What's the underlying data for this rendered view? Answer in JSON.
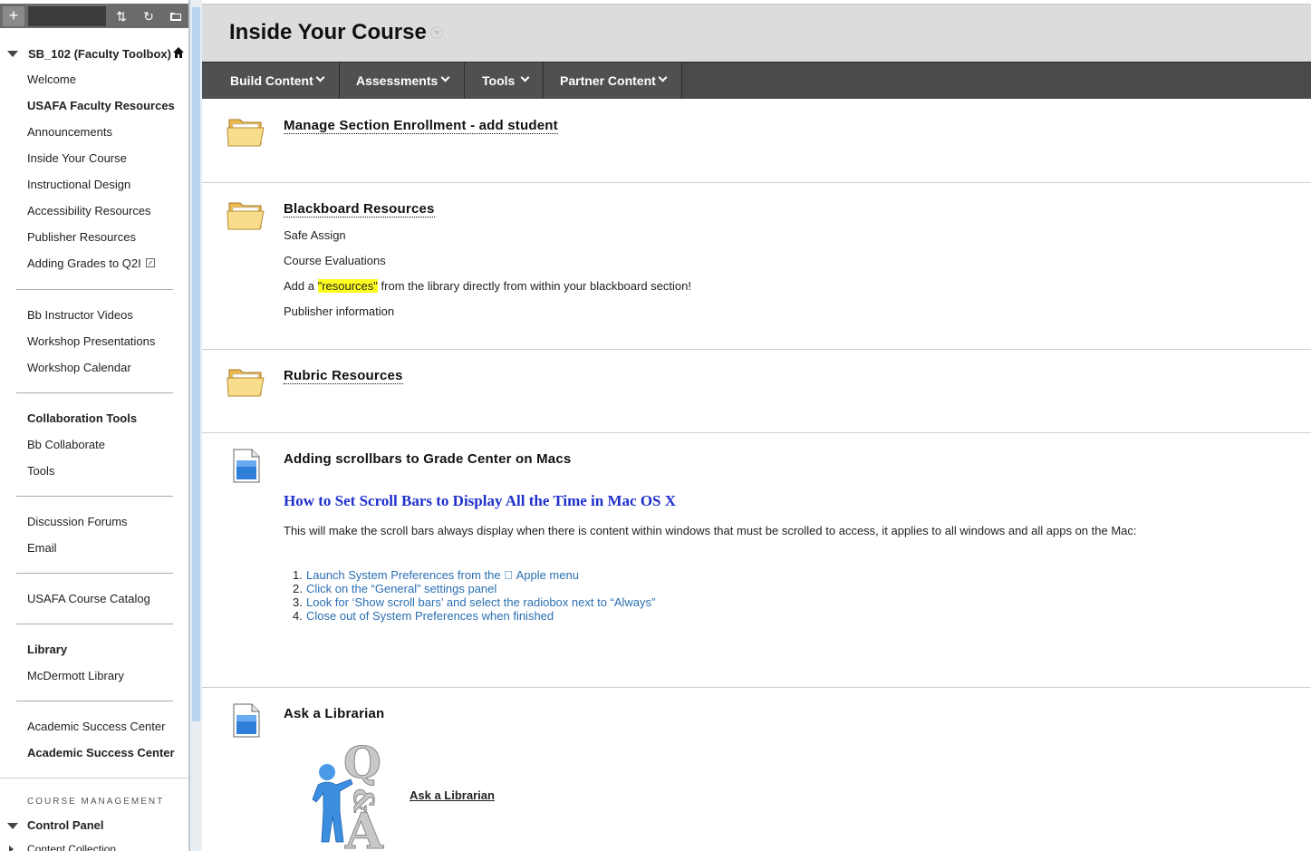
{
  "sidebar": {
    "toolbar": {
      "add_icon": "plus-icon",
      "sort_icon": "sort-arrows-icon",
      "refresh_icon": "refresh-icon",
      "folder_icon": "folder-view-icon"
    },
    "course_title": "SB_102 (Faculty Toolbox)",
    "items": [
      {
        "label": "Welcome",
        "bold": false
      },
      {
        "label": "USAFA Faculty Resources",
        "bold": true
      },
      {
        "label": "Announcements",
        "bold": false
      },
      {
        "label": "Inside Your Course",
        "bold": false
      },
      {
        "label": "Instructional Design",
        "bold": false
      },
      {
        "label": "Accessibility Resources",
        "bold": false
      },
      {
        "label": "Publisher Resources",
        "bold": false
      },
      {
        "label": "Adding Grades to Q2I",
        "bold": false
      },
      {
        "label": "Bb Instructor Videos",
        "bold": false
      },
      {
        "label": "Workshop Presentations",
        "bold": false
      },
      {
        "label": "Workshop Calendar",
        "bold": false
      },
      {
        "label": "Collaboration Tools",
        "bold": true
      },
      {
        "label": "Bb Collaborate",
        "bold": false
      },
      {
        "label": "Tools",
        "bold": false
      },
      {
        "label": "Discussion Forums",
        "bold": false
      },
      {
        "label": "Email",
        "bold": false
      },
      {
        "label": "USAFA Course Catalog",
        "bold": false
      },
      {
        "label": "Library",
        "bold": true
      },
      {
        "label": "McDermott Library",
        "bold": false
      },
      {
        "label": "Academic Success Center",
        "bold": false
      },
      {
        "label": "Academic Success Center",
        "bold": true
      }
    ],
    "course_management_heading": "COURSE MANAGEMENT",
    "control_panel": "Control Panel",
    "content_collection": "Content Collection"
  },
  "header": {
    "title": "Inside Your Course"
  },
  "action_bar": {
    "build_content": "Build Content",
    "assessments": "Assessments",
    "tools": "Tools",
    "partner_content": "Partner Content"
  },
  "content": {
    "enrollment": {
      "title": "Manage Section Enrollment - add student"
    },
    "bb_resources": {
      "title": "Blackboard Resources",
      "line1": "Safe Assign",
      "line2": "Course Evaluations",
      "line3_pre": "Add a ",
      "line3_highlight": "\"resources\"",
      "line3_post": " from the library directly from within your blackboard section!",
      "line4": "Publisher information"
    },
    "rubric": {
      "title": "Rubric Resources"
    },
    "scrollbars": {
      "title": "Adding scrollbars to Grade Center on Macs",
      "heading": "How to Set Scroll Bars to Display All the Time in Mac OS X",
      "description": "This will make the scroll bars always display when there is content within windows that must be scrolled to access, it applies to all windows and all apps on the Mac:",
      "steps": [
        {
          "num": "1.",
          "text": "Launch System Preferences from the  Apple menu"
        },
        {
          "num": "2.",
          "text": "Click on the “General” settings panel"
        },
        {
          "num": "3.",
          "text": "Look for ‘Show scroll bars’ and select the radiobox next to “Always”"
        },
        {
          "num": "4.",
          "text": "Close out of System Preferences when finished"
        }
      ]
    },
    "librarian": {
      "title": "Ask a Librarian",
      "link": "Ask a Librarian",
      "image_text": "Q&A"
    }
  },
  "colors": {
    "action_bar": "#4a4a4a",
    "title_bar": "#dcdcdc",
    "link_blue": "#2a6fb3",
    "heading_blue": "#1e2fcc",
    "highlight": "#ffff1f"
  }
}
